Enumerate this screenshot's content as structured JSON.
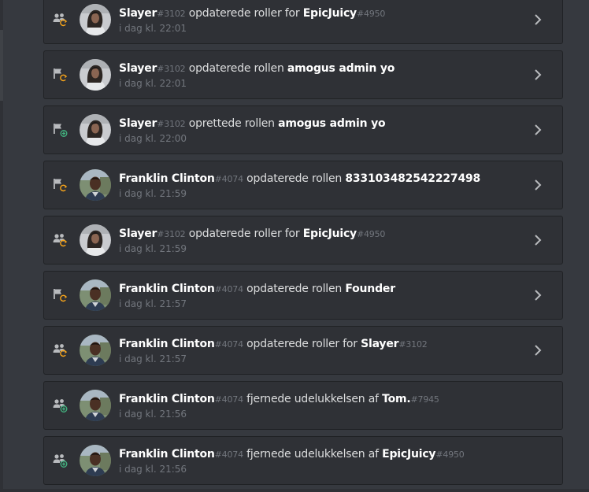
{
  "colors": {
    "background": "#36393f",
    "card": "#2f3136",
    "card_border": "#202225",
    "text": "#dcddde",
    "muted": "#72767d",
    "update_accent": "#faa61a",
    "create_accent": "#43b581"
  },
  "audit_log": {
    "entries": [
      {
        "icon": "members-update-icon",
        "accent": "update",
        "avatar": "slayer",
        "user": "Slayer",
        "user_discriminator": "#3102",
        "action": "opdaterede roller for",
        "target": "EpicJuicy",
        "target_discriminator": "#4950",
        "time": "i dag kl. 22:01",
        "expandable": true
      },
      {
        "icon": "role-flag-update-icon",
        "accent": "update",
        "avatar": "slayer",
        "user": "Slayer",
        "user_discriminator": "#3102",
        "action": "opdaterede rollen",
        "target": "amogus admin yo",
        "target_discriminator": "",
        "time": "i dag kl. 22:01",
        "expandable": true
      },
      {
        "icon": "role-flag-create-icon",
        "accent": "create",
        "avatar": "slayer",
        "user": "Slayer",
        "user_discriminator": "#3102",
        "action": "oprettede rollen",
        "target": "amogus admin yo",
        "target_discriminator": "",
        "time": "i dag kl. 22:00",
        "expandable": true
      },
      {
        "icon": "role-flag-update-icon",
        "accent": "update",
        "avatar": "franklin",
        "user": "Franklin Clinton",
        "user_discriminator": "#4074",
        "action": "opdaterede rollen",
        "target": "833103482542227498",
        "target_discriminator": "",
        "time": "i dag kl. 21:59",
        "expandable": true
      },
      {
        "icon": "members-update-icon",
        "accent": "update",
        "avatar": "slayer",
        "user": "Slayer",
        "user_discriminator": "#3102",
        "action": "opdaterede roller for",
        "target": "EpicJuicy",
        "target_discriminator": "#4950",
        "time": "i dag kl. 21:59",
        "expandable": true
      },
      {
        "icon": "role-flag-update-icon",
        "accent": "update",
        "avatar": "franklin",
        "user": "Franklin Clinton",
        "user_discriminator": "#4074",
        "action": "opdaterede rollen",
        "target": "Founder",
        "target_discriminator": "",
        "time": "i dag kl. 21:57",
        "expandable": true
      },
      {
        "icon": "members-update-icon",
        "accent": "update",
        "avatar": "franklin",
        "user": "Franklin Clinton",
        "user_discriminator": "#4074",
        "action": "opdaterede roller for",
        "target": "Slayer",
        "target_discriminator": "#3102",
        "time": "i dag kl. 21:57",
        "expandable": true
      },
      {
        "icon": "members-create-icon",
        "accent": "create",
        "avatar": "franklin",
        "user": "Franklin Clinton",
        "user_discriminator": "#4074",
        "action": "fjernede udelukkelsen af",
        "target": "Tom.",
        "target_discriminator": "#7945",
        "time": "i dag kl. 21:56",
        "expandable": false
      },
      {
        "icon": "members-create-icon",
        "accent": "create",
        "avatar": "franklin",
        "user": "Franklin Clinton",
        "user_discriminator": "#4074",
        "action": "fjernede udelukkelsen af",
        "target": "EpicJuicy",
        "target_discriminator": "#4950",
        "time": "i dag kl. 21:56",
        "expandable": false
      }
    ]
  }
}
